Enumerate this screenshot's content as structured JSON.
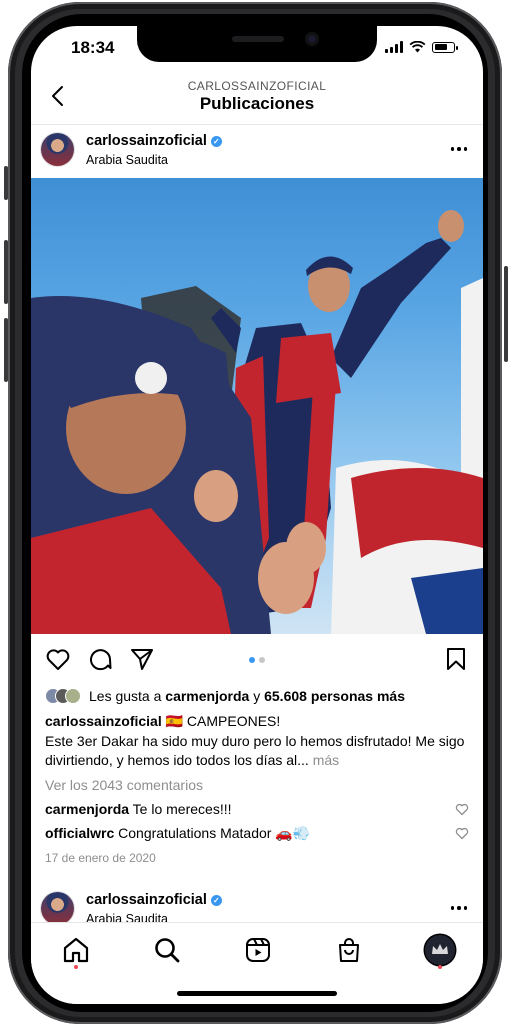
{
  "status_bar": {
    "time": "18:34"
  },
  "header": {
    "account": "CARLOSSAINZOFICIAL",
    "title": "Publicaciones"
  },
  "post": {
    "username": "carlossainzoficial",
    "location": "Arabia Saudita",
    "likes": {
      "prefix": "Les gusta a ",
      "user": "carmenjorda",
      "middle": " y ",
      "count": "65.608 personas más"
    },
    "caption": {
      "username": "carlossainzoficial",
      "first_line": " 🇪🇸 CAMPEONES!",
      "body": "Este 3er Dakar ha sido muy duro pero lo hemos disfrutado! Me sigo divirtiendo, y hemos ido todos los días al...",
      "more": "más"
    },
    "view_comments": "Ver los 2043 comentarios",
    "comments": [
      {
        "user": "carmenjorda",
        "text": " Te lo mereces!!!"
      },
      {
        "user": "officialwrc",
        "text": " Congratulations Matador 🚗💨"
      }
    ],
    "date": "17 de enero de 2020",
    "carousel": {
      "total": 2,
      "active": 1
    }
  },
  "next_post": {
    "username": "carlossainzoficial",
    "location": "Arabia Saudita"
  },
  "tabbar": {
    "items": [
      "home",
      "search",
      "reels",
      "shop",
      "profile"
    ]
  },
  "colors": {
    "verified": "#3897f0",
    "notification_dot": "#ed4956",
    "secondary_text": "#8e8e8e"
  }
}
